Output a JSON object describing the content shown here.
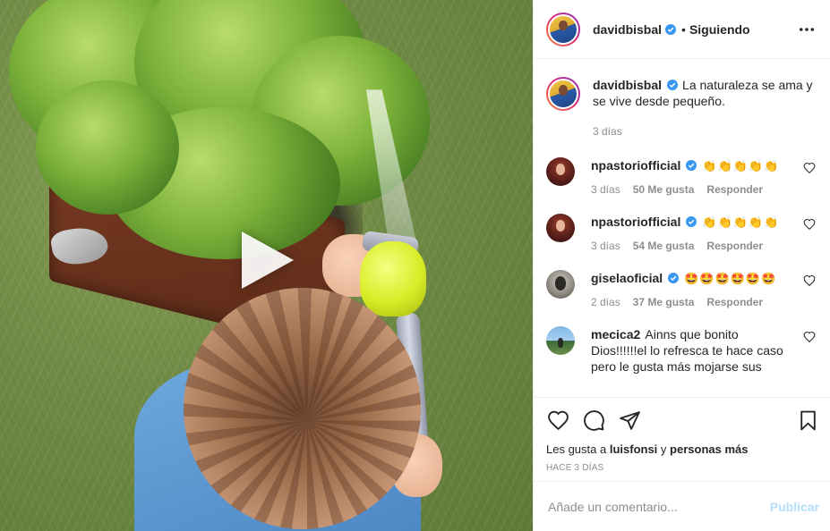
{
  "post": {
    "user": "davidbisbal",
    "follow_separator": "•",
    "follow_status": "Siguiendo",
    "more_icon": "more-options-icon",
    "play_icon": "play-icon"
  },
  "caption": {
    "user": "davidbisbal",
    "text": "La naturaleza se ama y se vive desde pequeño.",
    "time": "3 días"
  },
  "comments": [
    {
      "user": "npastoriofficial",
      "text": "👏👏👏👏👏",
      "time": "3 días",
      "likes": "50 Me gusta",
      "reply": "Responder"
    },
    {
      "user": "npastoriofficial",
      "text": "👏👏👏👏👏",
      "time": "3 días",
      "likes": "54 Me gusta",
      "reply": "Responder"
    },
    {
      "user": "giselaoficial",
      "text": "🤩🤩🤩🤩🤩🤩",
      "time": "2 días",
      "likes": "37 Me gusta",
      "reply": "Responder"
    },
    {
      "user": "mecica2",
      "text": "Ainns que bonito Dios!!!!!!el lo refresca te hace caso pero le gusta más mojarse sus"
    }
  ],
  "likes": {
    "prefix": "Les gusta a",
    "user": "luisfonsi",
    "joiner": "y",
    "others": "personas más"
  },
  "time_ago": "HACE 3 DÍAS",
  "add_comment": {
    "placeholder": "Añade un comentario...",
    "publish": "Publicar"
  },
  "colors": {
    "verified": "#3897f0",
    "publish_disabled": "#b2dffc",
    "text": "#262626",
    "muted": "#8e8e8e"
  }
}
